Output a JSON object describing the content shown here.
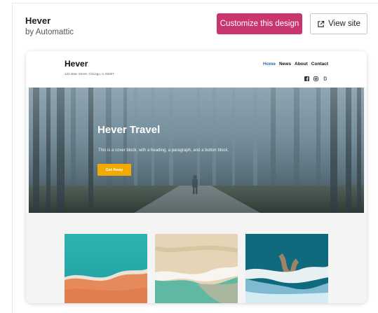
{
  "theme": {
    "name": "Hever",
    "author": "by Automattic"
  },
  "actions": {
    "customize_label": "Customize this design",
    "view_label": "View site"
  },
  "preview": {
    "site_title": "Hever",
    "address": "123 Main Street, Chicago, IL 60007",
    "nav": [
      {
        "label": "Home",
        "active": true
      },
      {
        "label": "News",
        "active": false
      },
      {
        "label": "About",
        "active": false
      },
      {
        "label": "Contact",
        "active": false
      }
    ],
    "social_icons": [
      "facebook-icon",
      "instagram-icon",
      "bandcamp-icon"
    ],
    "hero": {
      "title": "Hever Travel",
      "text": "This is a cover block, with a heading, a paragraph, and a button block.",
      "button_label": "Get Away"
    },
    "gallery": [
      "beach-aerial-1",
      "beach-aerial-2",
      "beach-aerial-3"
    ]
  },
  "colors": {
    "customize_bg": "#c9356e",
    "nav_active": "#2271b1",
    "hero_button": "#f2a900"
  }
}
